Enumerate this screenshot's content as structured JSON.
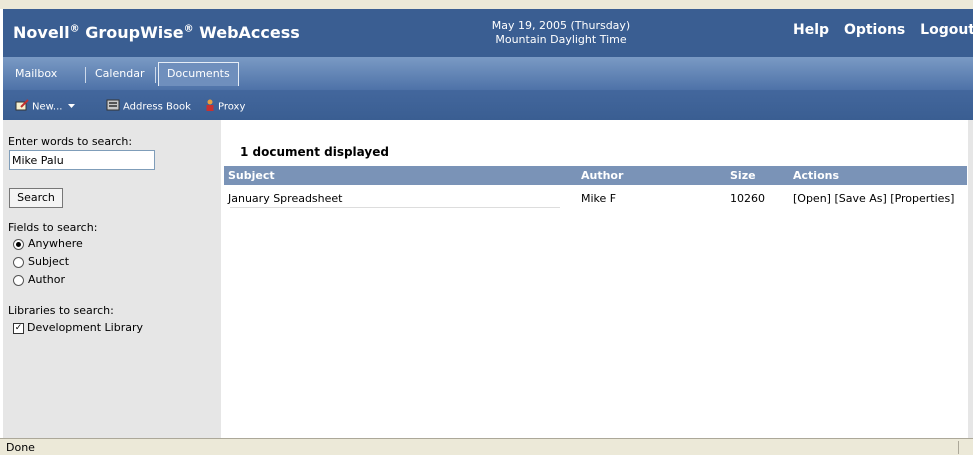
{
  "header": {
    "brand_part1": "Novell",
    "brand_part2": " GroupWise",
    "brand_part3": " WebAccess",
    "reg": "®",
    "date": "May 19, 2005 (Thursday)",
    "timezone": "Mountain Daylight Time",
    "links": {
      "help": "Help",
      "options": "Options",
      "logout": "Logout"
    }
  },
  "tabs": [
    {
      "label": "Mailbox"
    },
    {
      "label": "Calendar"
    },
    {
      "label": "Documents",
      "active": true
    }
  ],
  "toolbar": {
    "new_label": "New...",
    "address_book_label": "Address Book",
    "proxy_label": "Proxy"
  },
  "search": {
    "prompt": "Enter words to search:",
    "value": "Mike Palu",
    "button": "Search",
    "fields_label": "Fields to search:",
    "fields": [
      {
        "label": "Anywhere",
        "checked": true
      },
      {
        "label": "Subject",
        "checked": false
      },
      {
        "label": "Author",
        "checked": false
      }
    ],
    "libraries_label": "Libraries to search:",
    "libraries": [
      {
        "label": "Development Library",
        "checked": true
      }
    ]
  },
  "results": {
    "count_text": "1 document displayed",
    "columns": [
      "Subject",
      "Author",
      "Size",
      "Actions"
    ],
    "rows": [
      {
        "subject": "January Spreadsheet",
        "author": "Mike F",
        "size": "10260",
        "actions": "[Open] [Save As] [Properties]"
      }
    ]
  },
  "status": {
    "text": "Done"
  },
  "colors": {
    "header": "#3a5e92",
    "table_header": "#7a93b7",
    "panel": "#e6e6e6"
  }
}
